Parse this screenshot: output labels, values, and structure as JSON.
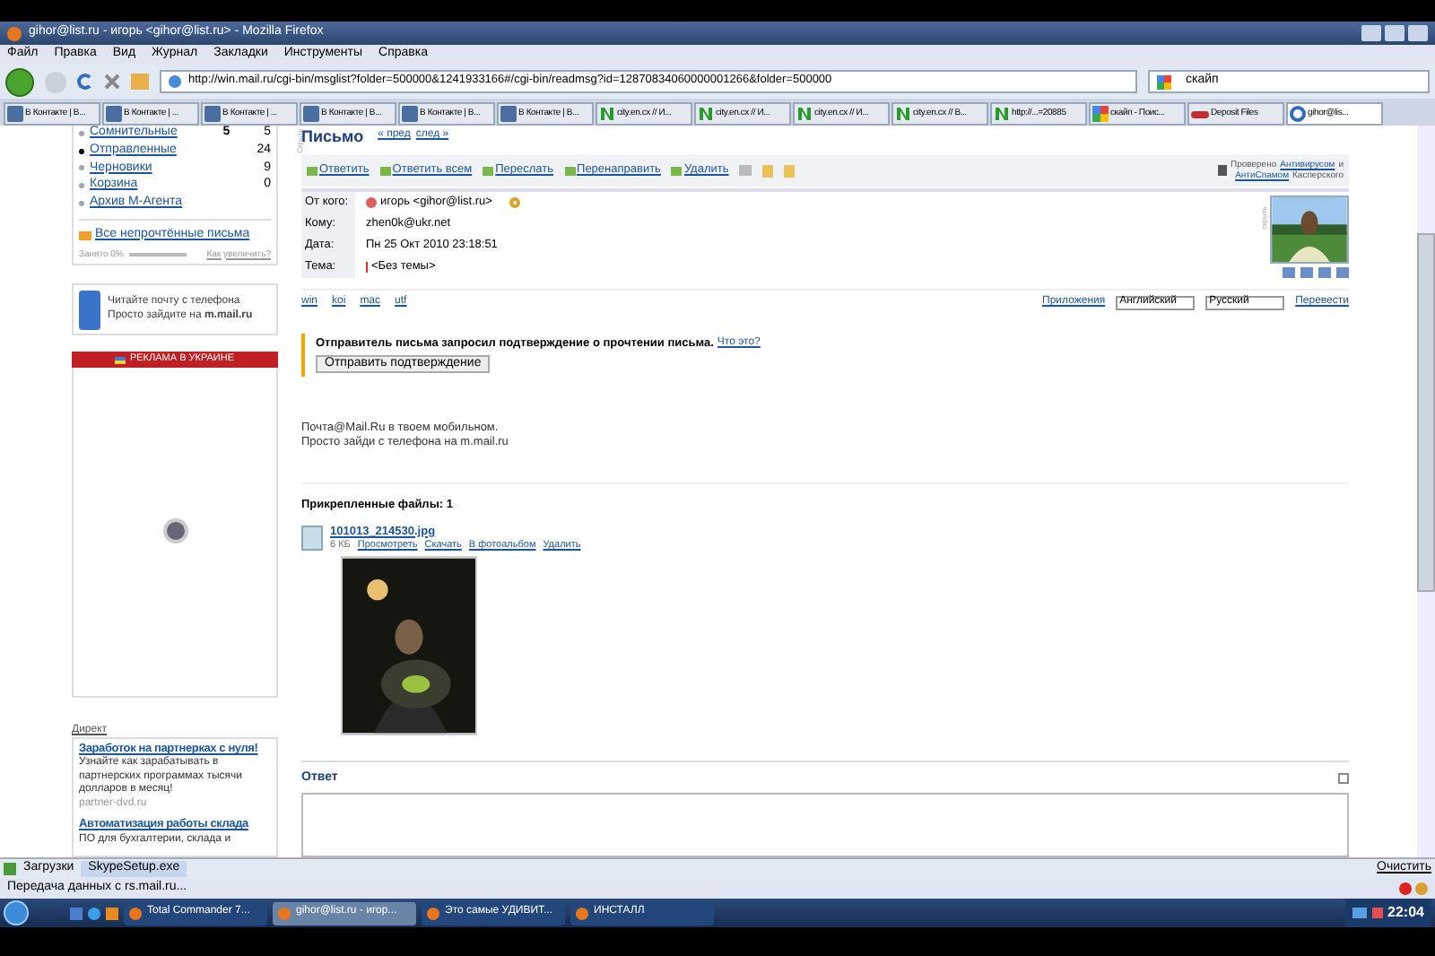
{
  "window": {
    "title": "gihor@list.ru - игорь <gihor@list.ru> - Mozilla Firefox"
  },
  "menu": [
    "Файл",
    "Правка",
    "Вид",
    "Журнал",
    "Закладки",
    "Инструменты",
    "Справка"
  ],
  "address": {
    "url": "http://win.mail.ru/cgi-bin/msglist?folder=500000&1241933166#/cgi-bin/readmsg?id=12870834060000001266&folder=500000"
  },
  "search": {
    "value": "скайп"
  },
  "tabs": [
    {
      "label": "В Контакте | В...",
      "kind": "vk",
      "selected": false
    },
    {
      "label": "В Контакте | ...",
      "kind": "vk",
      "selected": false
    },
    {
      "label": "В Контакте | ...",
      "kind": "vk",
      "selected": false
    },
    {
      "label": "В Контакте | В...",
      "kind": "vk",
      "selected": false
    },
    {
      "label": "В Контакте | В...",
      "kind": "vk",
      "selected": false
    },
    {
      "label": "В Контакте | В...",
      "kind": "vk",
      "selected": false
    },
    {
      "label": "city.en.cx // И...",
      "kind": "en",
      "selected": false
    },
    {
      "label": "city.en.cx // И...",
      "kind": "en",
      "selected": false
    },
    {
      "label": "city.en.cx // И...",
      "kind": "en",
      "selected": false
    },
    {
      "label": "city.en.cx // В...",
      "kind": "en",
      "selected": false
    },
    {
      "label": "http://...=20885",
      "kind": "en",
      "selected": false
    },
    {
      "label": "скайп - Поис...",
      "kind": "google",
      "selected": false
    },
    {
      "label": "Deposit Files",
      "kind": "deposit",
      "selected": false
    },
    {
      "label": "gihor@lis...",
      "kind": "mail",
      "selected": true
    }
  ],
  "sidebar": {
    "folders": [
      {
        "name": "Сомнительные",
        "unread": "5",
        "count": "5",
        "selected": false
      },
      {
        "name": "Отправленные",
        "count": "24",
        "selected": true
      },
      {
        "name": "Черновики",
        "count": "9",
        "selected": false
      },
      {
        "name": "Корзина",
        "count": "0",
        "selected": false
      },
      {
        "name": "Архив М-Агента",
        "selected": false
      }
    ],
    "unread_link": "Все непрочтённые письма",
    "quota": {
      "label": "Занято 0%",
      "level": 0,
      "link": "Как увеличить?"
    },
    "mobile": {
      "line1": "Читайте почту с телефона",
      "line2": "Просто зайдите на **m.mail.ru**"
    },
    "ad_banner": "РЕКЛАМА В УКРАИНЕ",
    "hide": "Скрыть",
    "direct": {
      "title": "Директ",
      "ads": [
        {
          "title": "Заработок на партнерках с нуля!",
          "text": "Узнайте как зарабатывать в партнерских программах тысячи долларов в месяц!",
          "site": "partner-dvd.ru"
        },
        {
          "title": "Автоматизация работы склада",
          "text": "ПО для бухгалтерии, склада и"
        }
      ]
    }
  },
  "letter": {
    "title": "Письмо",
    "prev": "« пред",
    "next": "след »",
    "actions": [
      "Ответить",
      "Ответить всем",
      "Переслать",
      "Перенаправить",
      "Удалить"
    ],
    "antivirus": {
      "prefix": "Проверено",
      "av": "Антивирусом",
      "and": "и",
      "as": "АнтиСпамом",
      "suffix": "Касперского"
    },
    "fields": [
      {
        "label": "От кого:",
        "value": "игорь <gihor@list.ru>",
        "kind": "sender"
      },
      {
        "label": "Кому:",
        "value": "zhen0k@ukr.net",
        "kind": "text"
      },
      {
        "label": "Дата:",
        "value": "Пн 25 Окт 2010 23:18:51",
        "kind": "text"
      },
      {
        "label": "Тема:",
        "value": "<Без темы>",
        "kind": "subject"
      }
    ],
    "hide_photo": "скрыть",
    "encodings": [
      "win",
      "koi",
      "mac",
      "utf"
    ],
    "apps": "Приложения",
    "lang_from": "Английский",
    "lang_to": "Русский",
    "translate": "Перевести",
    "notice": {
      "text": "Отправитель письма запросил подтверждение о прочтении письма.",
      "link": "Что это?",
      "button": "Отправить подтверждение"
    },
    "body": [
      "Почта@Mail.Ru в твоем мобильном.",
      "Просто зайди с телефона на m.mail.ru"
    ],
    "attachments": {
      "title": "Прикрепленные файлы: 1",
      "file": "101013_214530.jpg",
      "size": "6 КБ",
      "links": [
        "Просмотреть",
        "Скачать",
        "В фотоальбом",
        "Удалить"
      ]
    },
    "reply_title": "Ответ"
  },
  "downloads": {
    "label": "Загрузки",
    "file": "SkypeSetup.exe",
    "clear": "Очистить"
  },
  "status_bar": "Передача данных с rs.mail.ru...",
  "taskbar": {
    "items": [
      {
        "label": "Total Commander 7...",
        "selected": false
      },
      {
        "label": "gihor@list.ru - игор...",
        "selected": true
      },
      {
        "label": "Это самые УДИВИТ...",
        "selected": false
      },
      {
        "label": "ИНСТАЛЛ",
        "selected": false
      }
    ],
    "clock": "22:04"
  }
}
